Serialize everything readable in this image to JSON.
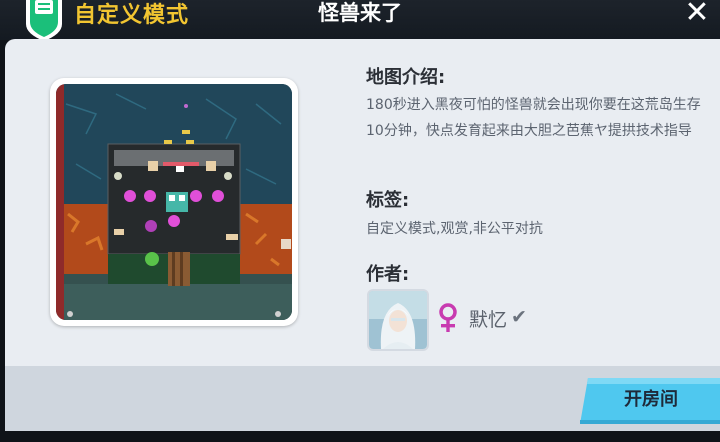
{
  "header": {
    "mode_title": "自定义模式",
    "map_title": "怪兽来了",
    "close_symbol": "✕",
    "mode_icon": "mode-badge-icon"
  },
  "info": {
    "intro_heading": "地图介绍:",
    "description": "180秒进入黑夜可怕的怪兽就会出现你要在这荒岛生存10分钟，快点发育起来由大胆之芭蕉ヤ提拱技术指导",
    "tags_heading": "标签:",
    "tags": "自定义模式,观赏,非公平对抗",
    "author_heading": "作者:",
    "author_name": "默忆",
    "verify_mark": "✔",
    "gender_icon": "female-icon"
  },
  "actions": {
    "open_room": "开房间"
  },
  "colors": {
    "mode_title": "#f2c531",
    "badge": "#1bbf7a",
    "gender": "#c83bb0",
    "button": "#4fc8ef"
  }
}
